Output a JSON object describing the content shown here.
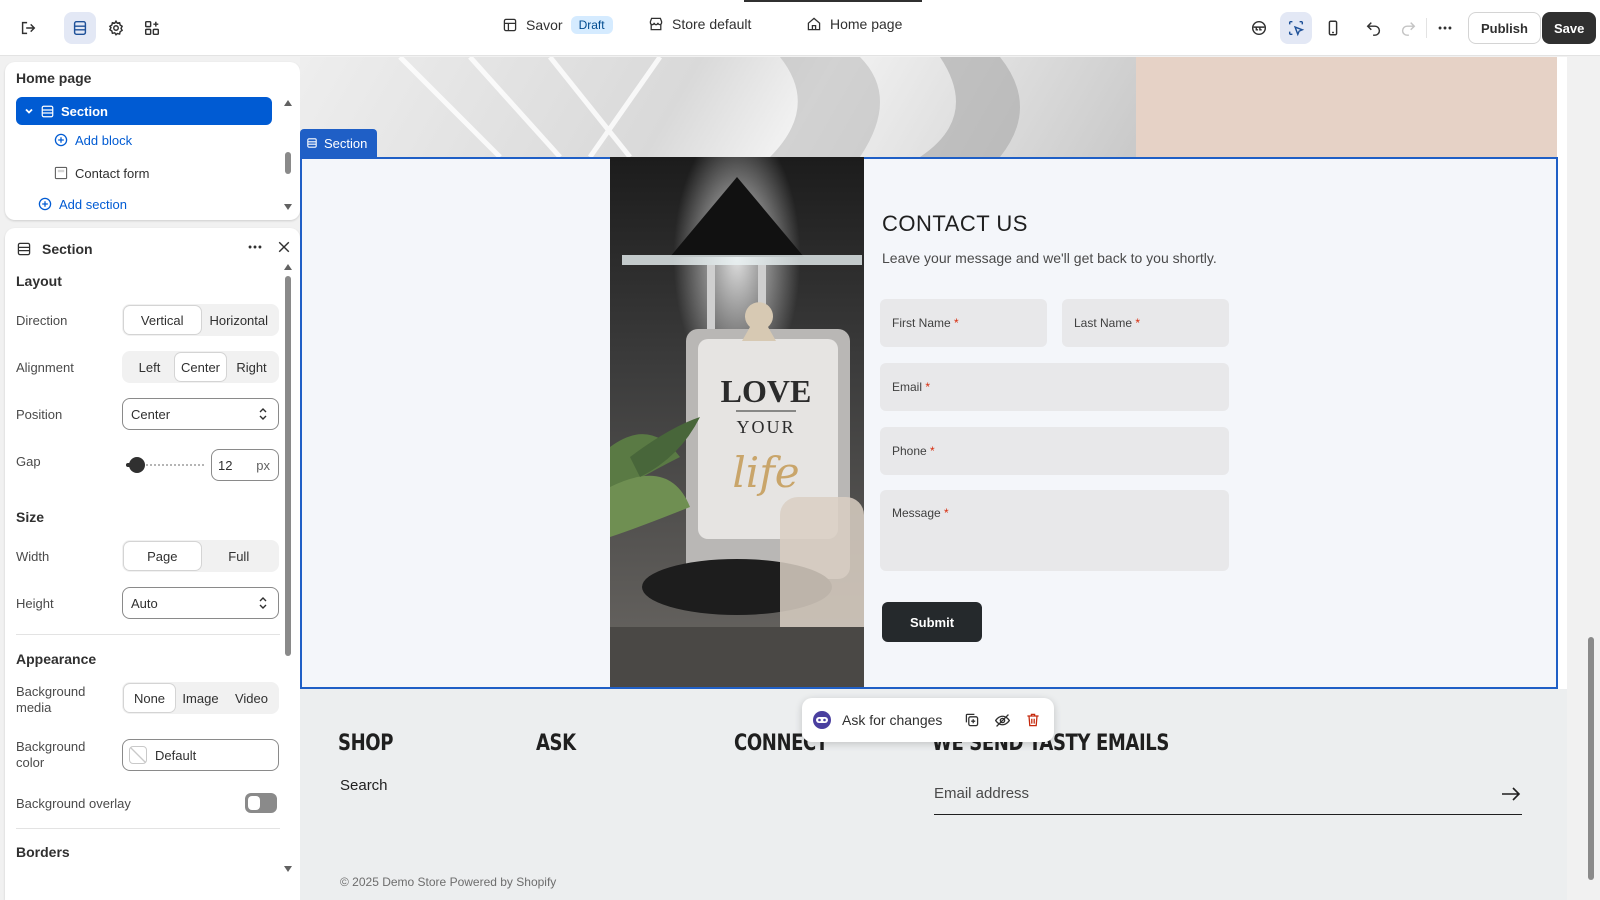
{
  "topbar": {
    "theme_name": "Savor",
    "status_badge": "Draft",
    "store": "Store default",
    "page": "Home page",
    "publish_label": "Publish",
    "save_label": "Save"
  },
  "tree": {
    "title": "Home page",
    "selected": "Section",
    "add_block": "Add block",
    "block_item": "Contact form",
    "add_section": "Add section"
  },
  "inspector": {
    "title": "Section",
    "layout": {
      "heading": "Layout",
      "direction_label": "Direction",
      "direction_options": [
        "Vertical",
        "Horizontal"
      ],
      "direction_value": "Vertical",
      "alignment_label": "Alignment",
      "alignment_options": [
        "Left",
        "Center",
        "Right"
      ],
      "alignment_value": "Center",
      "position_label": "Position",
      "position_value": "Center",
      "gap_label": "Gap",
      "gap_value": "12",
      "gap_unit": "px"
    },
    "size": {
      "heading": "Size",
      "width_label": "Width",
      "width_options": [
        "Page",
        "Full"
      ],
      "width_value": "Page",
      "height_label": "Height",
      "height_value": "Auto"
    },
    "appearance": {
      "heading": "Appearance",
      "bg_media_label": "Background media",
      "bg_media_options": [
        "None",
        "Image",
        "Video"
      ],
      "bg_media_value": "None",
      "bg_color_label": "Background color",
      "bg_color_value": "Default",
      "bg_overlay_label": "Background overlay",
      "bg_overlay_on": false
    },
    "borders": {
      "heading": "Borders"
    }
  },
  "preview": {
    "section_tag": "Section",
    "photo_text": [
      "LOVE",
      "YOUR",
      "life"
    ],
    "contact_title": "CONTACT US",
    "contact_subtitle": "Leave your message and we'll get back to you shortly.",
    "fields": {
      "first_name": "First Name",
      "last_name": "Last Name",
      "email": "Email",
      "phone": "Phone",
      "message": "Message",
      "required_mark": "*"
    },
    "submit_label": "Submit",
    "footer": {
      "col1": "SHOP",
      "col2": "ASK",
      "col3": "CONNECT",
      "col4": "WE SEND TASTY EMAILS",
      "link_search": "Search",
      "email_placeholder": "Email address",
      "copyright": "© 2025 Demo Store  Powered by Shopify"
    }
  },
  "ask_pill": {
    "label": "Ask for changes"
  },
  "colors": {
    "accent": "#005bd3",
    "section_outline": "#1f5fc6",
    "save_bg": "#303030",
    "peach": "#e6d2c6",
    "submit_bg": "#25292c"
  }
}
